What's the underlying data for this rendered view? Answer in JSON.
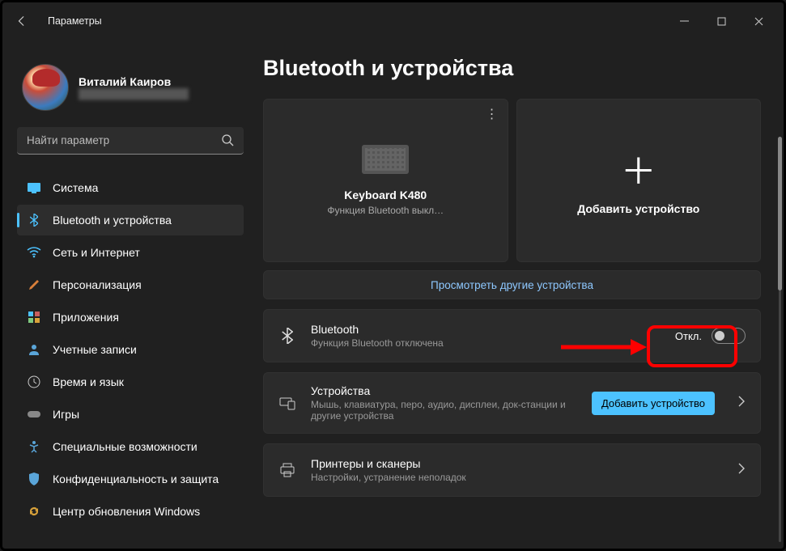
{
  "titlebar": {
    "title": "Параметры"
  },
  "profile": {
    "name": "Виталий Каиров",
    "email": "████████████████"
  },
  "search": {
    "placeholder": "Найти параметр"
  },
  "nav": [
    {
      "id": "system",
      "label": "Система"
    },
    {
      "id": "bluetooth",
      "label": "Bluetooth и устройства"
    },
    {
      "id": "network",
      "label": "Сеть и Интернет"
    },
    {
      "id": "personalization",
      "label": "Персонализация"
    },
    {
      "id": "apps",
      "label": "Приложения"
    },
    {
      "id": "accounts",
      "label": "Учетные записи"
    },
    {
      "id": "time",
      "label": "Время и язык"
    },
    {
      "id": "gaming",
      "label": "Игры"
    },
    {
      "id": "accessibility",
      "label": "Специальные возможности"
    },
    {
      "id": "privacy",
      "label": "Конфиденциальность и защита"
    },
    {
      "id": "update",
      "label": "Центр обновления Windows"
    }
  ],
  "page": {
    "heading": "Bluetooth и устройства",
    "device_tile": {
      "name": "Keyboard K480",
      "status": "Функция Bluetooth выкл…"
    },
    "add_tile": {
      "label": "Добавить устройство"
    },
    "view_more": "Просмотреть другие устройства",
    "bluetooth_card": {
      "title": "Bluetooth",
      "sub": "Функция Bluetooth отключена",
      "toggle_label": "Откл."
    },
    "devices_card": {
      "title": "Устройства",
      "sub": "Мышь, клавиатура, перо, аудио, дисплеи, док-станции и другие устройства",
      "button": "Добавить устройство"
    },
    "printers_card": {
      "title": "Принтеры и сканеры",
      "sub": "Настройки, устранение неполадок"
    }
  }
}
